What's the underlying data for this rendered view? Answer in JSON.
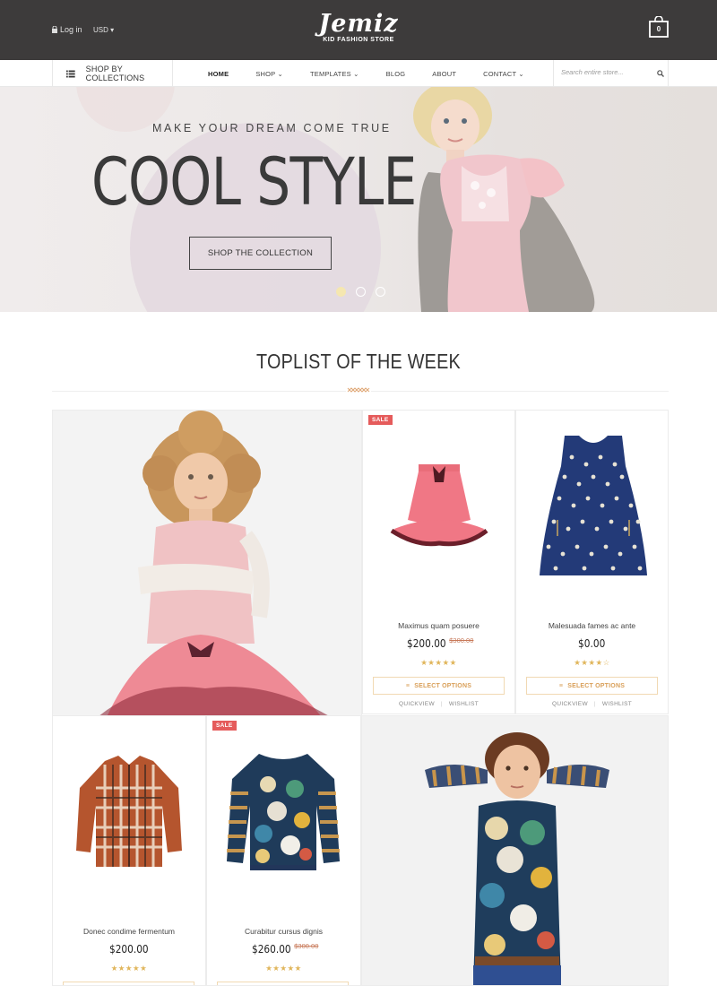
{
  "header": {
    "login_label": "Log in",
    "currency": "USD",
    "brand": "Jemiz",
    "tagline": "KID FASHION STORE",
    "cart_count": "0"
  },
  "nav": {
    "collections_label": "SHOP BY COLLECTIONS",
    "items": [
      {
        "label": "HOME",
        "caret": false
      },
      {
        "label": "SHOP",
        "caret": true
      },
      {
        "label": "TEMPLATES",
        "caret": true
      },
      {
        "label": "BLOG",
        "caret": false
      },
      {
        "label": "ABOUT",
        "caret": false
      },
      {
        "label": "CONTACT",
        "caret": true
      }
    ],
    "search_placeholder": "Search entire store..."
  },
  "hero": {
    "tagline": "MAKE YOUR DREAM COME TRUE",
    "title": "COOL STYLE",
    "button": "SHOP THE COLLECTION",
    "slide_count": 3,
    "active_slide": 1
  },
  "section": {
    "title": "TOPLIST OF THE WEEK"
  },
  "products": [
    {
      "name": "Maximus quam posuere",
      "price": "$200.00",
      "old_price": "$300.00",
      "sale": "SALE",
      "rating": 5,
      "rating_text": "★★★★★",
      "button": "SELECT OPTIONS",
      "quickview": "QUICKVIEW",
      "wishlist": "WISHLIST"
    },
    {
      "name": "Malesuada fames ac ante",
      "price": "$0.00",
      "old_price": "",
      "sale": "",
      "rating": 4,
      "rating_text": "★★★★☆",
      "button": "SELECT OPTIONS",
      "quickview": "QUICKVIEW",
      "wishlist": "WISHLIST"
    },
    {
      "name": "Donec condime fermentum",
      "price": "$200.00",
      "old_price": "",
      "sale": "",
      "rating": 5,
      "rating_text": "★★★★★"
    },
    {
      "name": "Curabitur cursus dignis",
      "price": "$260.00",
      "old_price": "$300.00",
      "sale": "SALE",
      "rating": 5,
      "rating_text": "★★★★★"
    }
  ],
  "colors": {
    "topbar": "#3d3b3b",
    "sale_badge": "#e55b5b",
    "accent_gold": "#d9a05a",
    "star": "#e0b55a"
  }
}
